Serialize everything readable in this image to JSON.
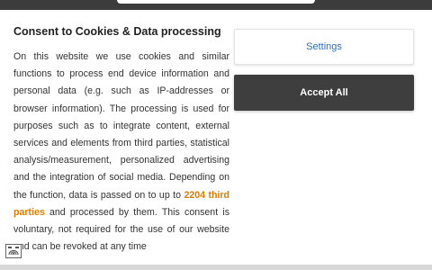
{
  "dialog": {
    "title": "Consent to Cookies & Data processing",
    "body_part1": "On this website we use cookies and similar functions to process end device information and personal data (e.g. such as IP-addresses or browser information). The processing is used for purposes such as to integrate content, external services and elements from third parties, statistical analysis/measurement, personalized advertising and the integration of social media. Depending on the function, data is passed on to up to ",
    "third_parties_link": "2204 third parties",
    "body_part2": " and processed by them. This consent is voluntary, not required for the use of our website and can be revoked at any time"
  },
  "buttons": {
    "settings_label": "Settings",
    "accept_all_label": "Accept All"
  },
  "colors": {
    "accent_link": "#e07b00",
    "settings_text": "#2a6ebb",
    "accept_bg": "#3e3e3e"
  },
  "icons": {
    "consent_settings": "fingerprint-icon"
  }
}
